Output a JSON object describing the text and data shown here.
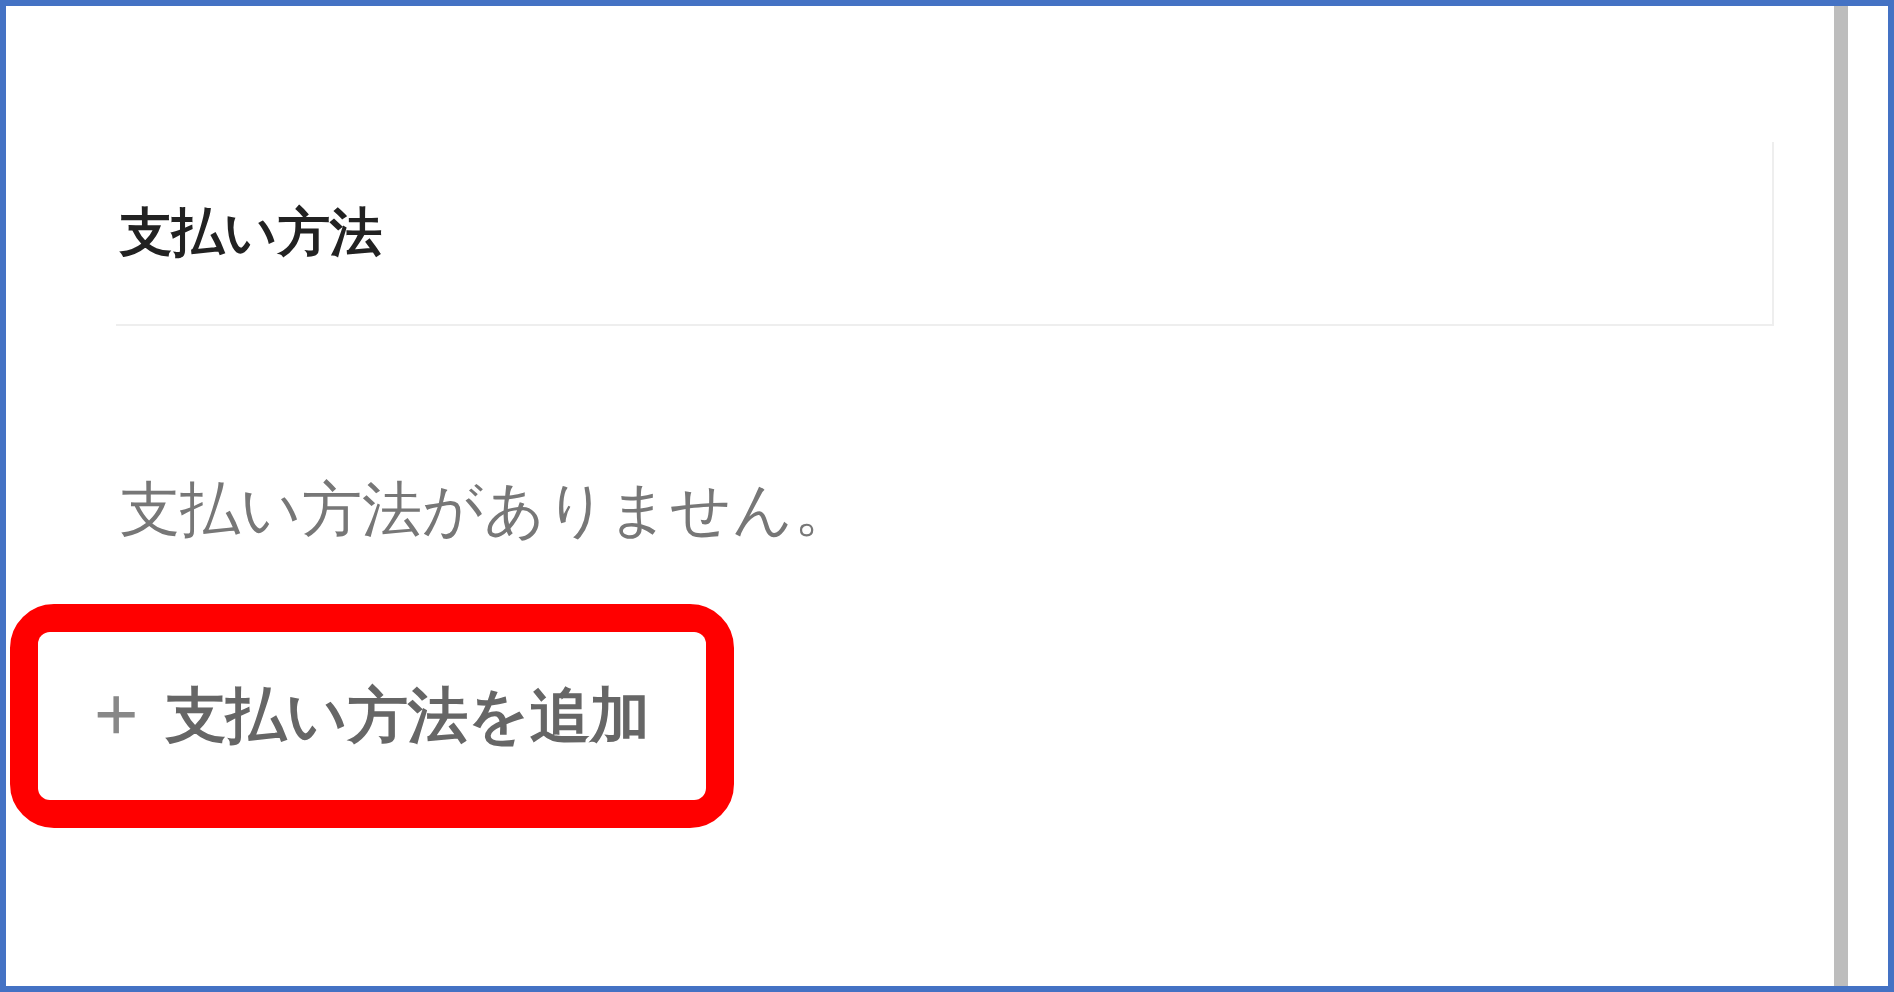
{
  "card": {
    "title": "支払い方法",
    "empty_message": "支払い方法がありません。",
    "add_button": {
      "icon": "+",
      "label": "支払い方法を追加",
      "highlighted": true
    }
  }
}
